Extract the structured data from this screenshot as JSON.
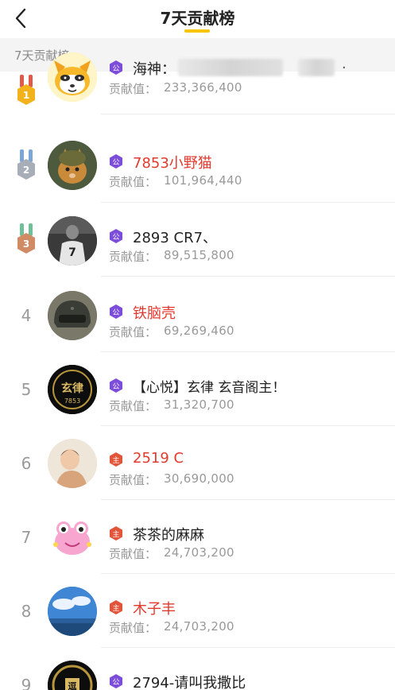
{
  "header": {
    "title": "7天贡献榜"
  },
  "section": {
    "label": "7天贡献榜"
  },
  "contrib_label": "贡献值：",
  "colors": {
    "accent": "#f7c600",
    "red_name": "#e23a2e",
    "badge_gong": "#7c4ddb",
    "badge_zhu": "#e2553a",
    "gold": "#f2b21b",
    "silver": "#a8aeb8",
    "bronze": "#d08a64"
  },
  "entries": [
    {
      "rank": "1",
      "medal": "gold",
      "badge": "公",
      "name": "海神：",
      "value": "233,366,400",
      "red": false
    },
    {
      "rank": "2",
      "medal": "silver",
      "badge": "公",
      "name": "7853小野猫",
      "value": "101,964,440",
      "red": true
    },
    {
      "rank": "3",
      "medal": "bronze",
      "badge": "公",
      "name": "2893  CR7、",
      "value": "89,515,800",
      "red": false
    },
    {
      "rank": "4",
      "medal": "",
      "badge": "公",
      "name": "铁脑壳",
      "value": "69,269,460",
      "red": true
    },
    {
      "rank": "5",
      "medal": "",
      "badge": "公",
      "name": "【心悦】玄律 玄音阁主！",
      "value": "31,320,700",
      "red": false
    },
    {
      "rank": "6",
      "medal": "",
      "badge": "主",
      "name": "2519 C",
      "value": "30,690,000",
      "red": true
    },
    {
      "rank": "7",
      "medal": "",
      "badge": "主",
      "name": "茶茶的麻麻",
      "value": "24,703,200",
      "red": false
    },
    {
      "rank": "8",
      "medal": "",
      "badge": "主",
      "name": "木子丰",
      "value": "24,703,200",
      "red": true
    },
    {
      "rank": "9",
      "medal": "",
      "badge": "公",
      "name": "2794-请叫我撒比",
      "value": "",
      "red": false
    }
  ],
  "avatars": {
    "avatar5_text": "玄律",
    "avatar5_sub": "7853",
    "avatar9_text": "逗"
  }
}
